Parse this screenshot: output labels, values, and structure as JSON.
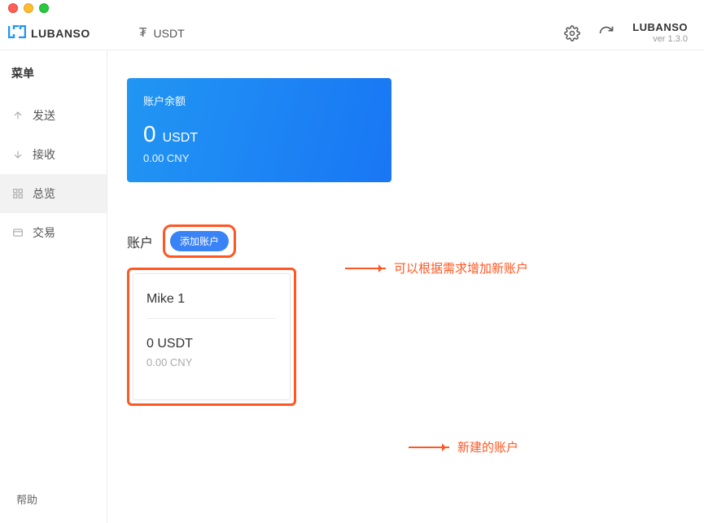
{
  "header": {
    "brand": "LUBANSO",
    "currency_symbol": "₮",
    "currency_label": "USDT",
    "version_title": "LUBANSO",
    "version_sub": "ver 1.3.0"
  },
  "sidebar": {
    "title": "菜单",
    "items": [
      {
        "label": "发送"
      },
      {
        "label": "接收"
      },
      {
        "label": "总览"
      },
      {
        "label": "交易"
      }
    ],
    "help": "帮助"
  },
  "balance": {
    "label": "账户余额",
    "amount": "0",
    "unit": "USDT",
    "secondary": "0.00 CNY"
  },
  "accounts": {
    "label": "账户",
    "add_label": "添加账户",
    "card": {
      "name": "Mike 1",
      "balance": "0 USDT",
      "secondary": "0.00 CNY"
    }
  },
  "annotations": {
    "add_note": "可以根据需求增加新账户",
    "card_note": "新建的账户"
  }
}
